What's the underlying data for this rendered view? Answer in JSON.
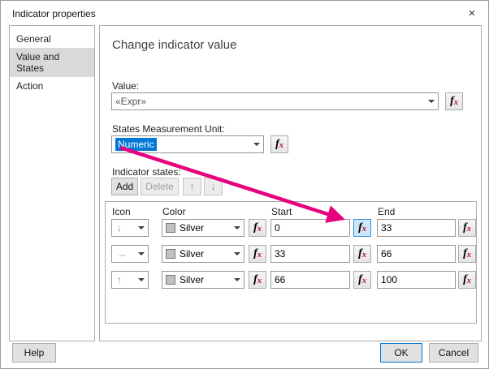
{
  "window": {
    "title": "Indicator properties",
    "close_glyph": "×"
  },
  "sidebar": {
    "items": [
      {
        "label": "General",
        "selected": false
      },
      {
        "label": "Value and States",
        "selected": true
      },
      {
        "label": "Action",
        "selected": false
      }
    ]
  },
  "content": {
    "heading": "Change indicator value",
    "value": {
      "label": "Value:",
      "text": "«Expr»"
    },
    "unit": {
      "label": "States Measurement Unit:",
      "value": "Numeric"
    },
    "states": {
      "label": "Indicator states:",
      "add_label": "Add",
      "delete_label": "Delete",
      "move_up_glyph": "↑",
      "move_down_glyph": "↓",
      "headers": {
        "icon": "Icon",
        "color": "Color",
        "start": "Start",
        "end": "End"
      },
      "rows": [
        {
          "icon_glyph": "↓",
          "color": "Silver",
          "start": "0",
          "end": "33"
        },
        {
          "icon_glyph": "→",
          "color": "Silver",
          "start": "33",
          "end": "66"
        },
        {
          "icon_glyph": "↑",
          "color": "Silver",
          "start": "66",
          "end": "100"
        }
      ]
    }
  },
  "fx": {
    "f": "f",
    "x": "x"
  },
  "footer": {
    "help": "Help",
    "ok": "OK",
    "cancel": "Cancel"
  },
  "colors": {
    "accent": "#0078d7",
    "annotation_arrow": "#e6007e",
    "silver_swatch": "#c0c0c0",
    "selected_sidebar_bg": "#d9d9d9"
  }
}
